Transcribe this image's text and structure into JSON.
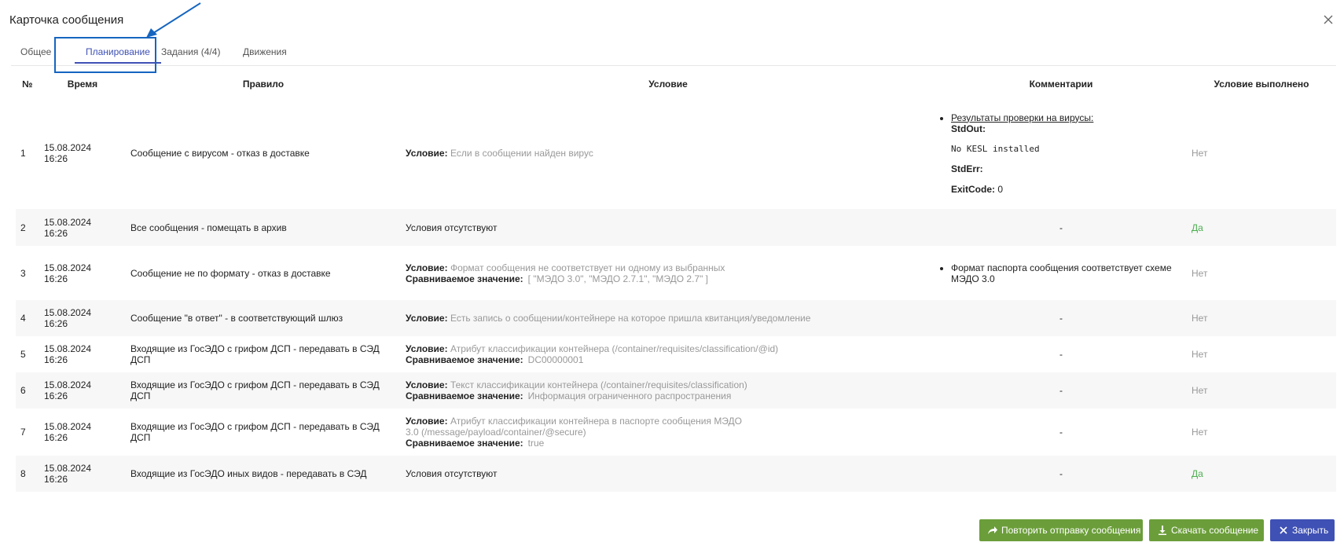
{
  "dialog": {
    "title": "Карточка сообщения"
  },
  "tabs": [
    {
      "label": "Общее"
    },
    {
      "label": "Планирование"
    },
    {
      "label": "Задания (4/4)"
    },
    {
      "label": "Движения"
    }
  ],
  "active_tab_index": 1,
  "table": {
    "headers": {
      "num": "№",
      "time": "Время",
      "rule": "Правило",
      "condition": "Условие",
      "comments": "Комментарии",
      "done": "Условие выполнено"
    },
    "cond_label": "Условие:",
    "compare_label": "Сравниваемое значение:",
    "rows": [
      {
        "num": "1",
        "date": "15.08.2024",
        "time": "16:26",
        "rule": "Сообщение с вирусом - отказ в доставке",
        "cond": "Если в сообщении найден вирус",
        "done": "Нет"
      },
      {
        "num": "2",
        "date": "15.08.2024",
        "time": "16:26",
        "rule": "Все сообщения - помещать в архив",
        "no_cond": "Условия отсутствуют",
        "comment": "-",
        "done": "Да"
      },
      {
        "num": "3",
        "date": "15.08.2024",
        "time": "16:26",
        "rule": "Сообщение не по формату - отказ в доставке",
        "cond": "Формат сообщения не соответствует ни одному из выбранных",
        "compare": "[ \"МЭДО 3.0\", \"МЭДО 2.7.1\", \"МЭДО 2.7\" ]",
        "comment_bullet": "Формат паспорта сообщения соответствует схеме МЭДО 3.0",
        "done": "Нет"
      },
      {
        "num": "4",
        "date": "15.08.2024",
        "time": "16:26",
        "rule": "Сообщение \"в ответ\" - в соответствующий шлюз",
        "cond": "Есть запись о сообщении/контейнере на которое пришла квитанция/уведомление",
        "comment": "-",
        "done": "Нет"
      },
      {
        "num": "5",
        "date": "15.08.2024",
        "time": "16:26",
        "rule": "Входящие из ГосЭДО с грифом ДСП - передавать в СЭД ДСП",
        "cond": "Атрибут классификации контейнера (/container/requisites/classification/@id)",
        "compare": "DC00000001",
        "comment": "-",
        "done": "Нет"
      },
      {
        "num": "6",
        "date": "15.08.2024",
        "time": "16:26",
        "rule": "Входящие из ГосЭДО с грифом ДСП - передавать в СЭД ДСП",
        "cond": "Текст классификации контейнера (/container/requisites/classification)",
        "compare": "Информация ограниченного распространения",
        "comment": "-",
        "done": "Нет"
      },
      {
        "num": "7",
        "date": "15.08.2024",
        "time": "16:26",
        "rule": "Входящие из ГосЭДО с грифом ДСП - передавать в СЭД ДСП",
        "cond": "Атрибут классификации контейнера в паспорте сообщения МЭДО 3.0 (/message/payload/container/@secure)",
        "compare": "true",
        "comment": "-",
        "done": "Нет"
      },
      {
        "num": "8",
        "date": "15.08.2024",
        "time": "16:26",
        "rule": "Входящие из ГосЭДО иных видов - передавать в СЭД",
        "no_cond": "Условия отсутствуют",
        "comment": "-",
        "done": "Да"
      }
    ],
    "virus_check": {
      "link": "Результаты проверки на вирусы:",
      "stdout_label": "StdOut:",
      "stdout_value": "No KESL installed",
      "stderr_label": "StdErr:",
      "exitcode_label": "ExitCode:",
      "exitcode_value": "0"
    }
  },
  "buttons": {
    "resend": "Повторить отправку сообщения",
    "download": "Скачать сообщение",
    "close": "Закрыть"
  },
  "icons": {
    "close": "close-icon",
    "resend": "share-arrow-icon",
    "download": "download-icon",
    "close_btn": "close-x-icon"
  },
  "colors": {
    "accent": "#3f51b5",
    "success": "#4caf50",
    "button_green": "#6b9e3a",
    "annotation": "#1565c0"
  }
}
